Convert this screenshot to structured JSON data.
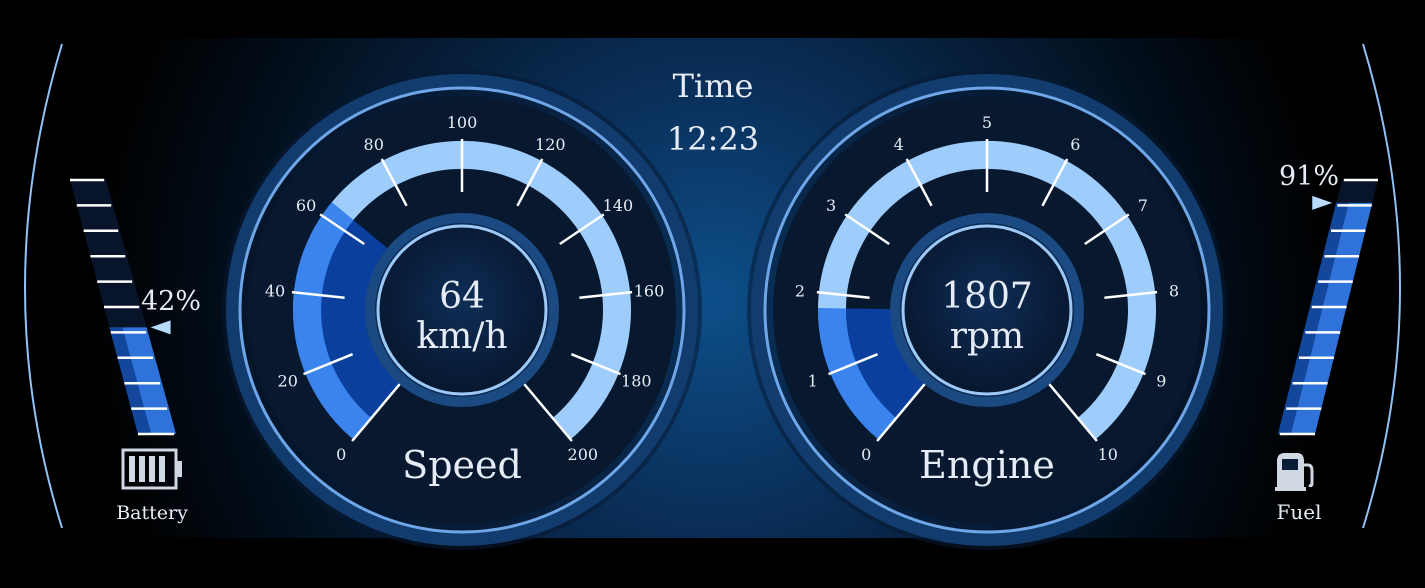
{
  "clock": {
    "label": "Time",
    "value": "12:23"
  },
  "speed": {
    "title": "Speed",
    "value": "64",
    "unit": "km/h",
    "level": 64,
    "min": 0,
    "max": 200,
    "ticks": [
      "0",
      "20",
      "40",
      "60",
      "80",
      "100",
      "120",
      "140",
      "160",
      "180",
      "200"
    ]
  },
  "engine": {
    "title": "Engine",
    "value": "1807",
    "unit": "rpm",
    "level": 1.807,
    "min": 0,
    "max": 10,
    "ticks": [
      "0",
      "1",
      "2",
      "3",
      "4",
      "5",
      "6",
      "7",
      "8",
      "9",
      "10"
    ]
  },
  "battery": {
    "label": "Battery",
    "percent_text": "42%",
    "level": 0.42,
    "icon": "battery-icon"
  },
  "fuel": {
    "label": "Fuel",
    "percent_text": "91%",
    "level": 0.91,
    "icon": "fuel-pump-icon"
  },
  "colors": {
    "background": "#000000",
    "glow": "#0d4f8a",
    "arc_track": "#9fcdfb",
    "arc_fill": "#1e6ad6",
    "ring": "#6fa6e8",
    "dial_face": "#0b2446",
    "text": "#e6ecf5",
    "bar_fill": "#2a6ed8",
    "bar_dark": "#0d3c8c"
  }
}
